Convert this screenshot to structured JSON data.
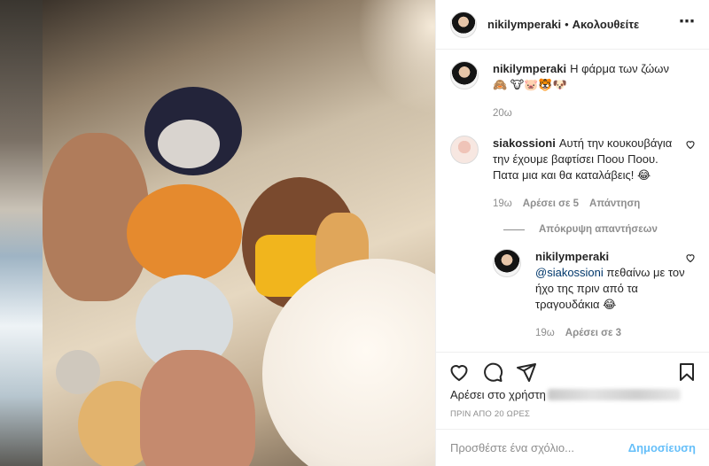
{
  "header": {
    "username": "nikilymperaki",
    "dot": "•",
    "follow_label": "Ακολουθείτε",
    "more_icon": "⋯"
  },
  "caption": {
    "username": "nikilymperaki",
    "text": "Η φάρμα των ζώων 🙈 🐮🐷🐯🐶",
    "time": "20ω"
  },
  "comments": [
    {
      "username": "siakossioni",
      "text": "Αυτή την κουκουβάγια την έχουμε βαφτίσει Πoου Ποου. Πατα μια και θα καταλάβεις! 😂",
      "time": "19ω",
      "likes": "Αρέσει σε 5",
      "reply_label": "Απάντηση"
    }
  ],
  "hide_replies_label": "Απόκρυψη απαντήσεων",
  "reply": {
    "username": "nikilymperaki",
    "mention": "@siakossioni",
    "text": " πεθαίνω με τον ήχο της πριν από τα τραγουδάκια 😂",
    "time": "19ω",
    "likes": "Αρέσει σε 3"
  },
  "likes_text": "Αρέσει στο χρήστη",
  "timestamp": "ΠΡΙΝ ΑΠΟ 20 ΩΡΕΣ",
  "comment_input": {
    "placeholder": "Προσθέστε ένα σχόλιο...",
    "post_label": "Δημοσίευση"
  }
}
